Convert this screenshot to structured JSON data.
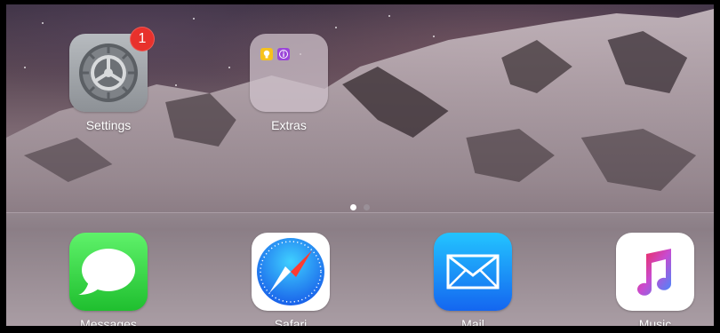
{
  "home_screen": {
    "apps": [
      {
        "label": "Settings",
        "icon": "settings-gear-icon",
        "badge": "1"
      },
      {
        "label": "Extras",
        "icon": "folder-icon",
        "folder_items": [
          "tips-icon",
          "info-icon"
        ]
      }
    ],
    "page_indicator": {
      "count": 2,
      "current": 1
    }
  },
  "dock": {
    "apps": [
      {
        "label": "Messages",
        "icon": "speech-bubble-icon",
        "color": "#3ad14a"
      },
      {
        "label": "Safari",
        "icon": "compass-icon",
        "color": "#1a8cff"
      },
      {
        "label": "Mail",
        "icon": "envelope-icon",
        "color": "#1c7cf5"
      },
      {
        "label": "Music",
        "icon": "music-note-icon",
        "color": "#fb3c66"
      }
    ]
  },
  "colors": {
    "badge": "#e8312c",
    "dot_active": "#ffffff",
    "dot_inactive": "#9a9098"
  }
}
